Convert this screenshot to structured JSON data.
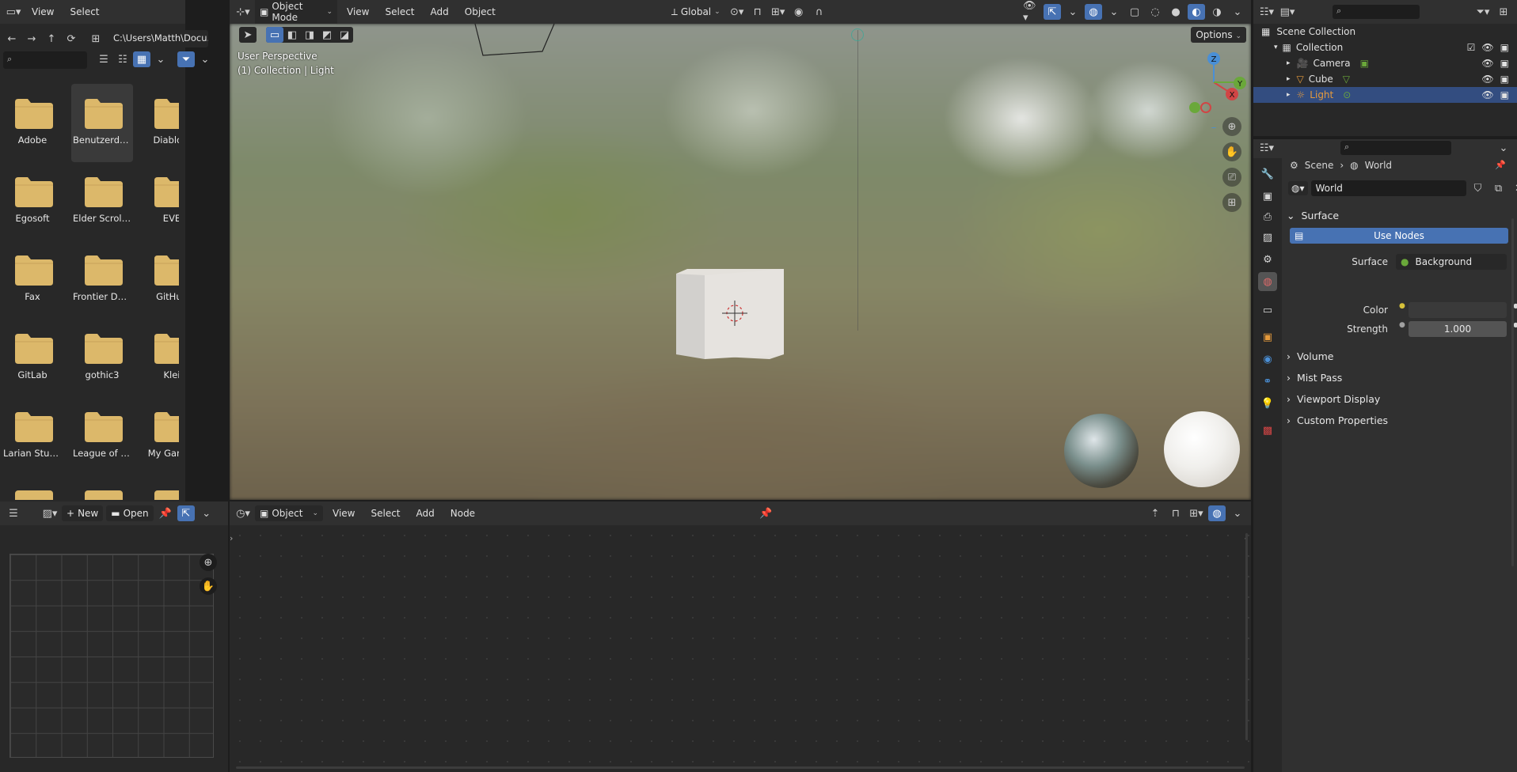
{
  "filebrowser": {
    "menu": [
      "View",
      "Select"
    ],
    "path": "C:\\Users\\Matth\\Docu...",
    "folders": [
      "Adobe",
      "Benutzerdefin...",
      "Diablo II",
      "Egosoft",
      "Elder Scrolls ...",
      "EVE",
      "Fax",
      "Frontier Deve...",
      "GitHub",
      "GitLab",
      "gothic3",
      "Klei",
      "Larian Studios",
      "League of Leg...",
      "My Games"
    ],
    "selected_folder": "Benutzerdefin..."
  },
  "viewport": {
    "mode": "Object Mode",
    "menu": [
      "View",
      "Select",
      "Add",
      "Object"
    ],
    "transform_orientation": "Global",
    "options_label": "Options",
    "overlay_title": "User Perspective",
    "overlay_subtitle": "(1) Collection | Light",
    "gizmo_axes": {
      "z": "Z",
      "x": "X",
      "y": "Y"
    }
  },
  "nodeeditor": {
    "type": "Object",
    "menu": [
      "View",
      "Select",
      "Add",
      "Node"
    ]
  },
  "imageeditor": {
    "new_label": "New",
    "open_label": "Open"
  },
  "outliner": {
    "root": "Scene Collection",
    "collection": "Collection",
    "items": [
      {
        "name": "Camera",
        "icon": "camera-icon",
        "color": "#e59a3c"
      },
      {
        "name": "Cube",
        "icon": "mesh-icon",
        "color": "#e59a3c"
      },
      {
        "name": "Light",
        "icon": "light-icon",
        "color": "#e59a3c"
      }
    ],
    "active_item": "Light"
  },
  "properties": {
    "breadcrumb": {
      "scene": "Scene",
      "world": "World"
    },
    "world_name": "World",
    "surface_panel": "Surface",
    "use_nodes_label": "Use Nodes",
    "surface_label": "Surface",
    "surface_value": "Background",
    "color_label": "Color",
    "strength_label": "Strength",
    "strength_value": "1.000",
    "collapsed_panels": [
      "Volume",
      "Mist Pass",
      "Viewport Display",
      "Custom Properties"
    ]
  },
  "colors": {
    "accent": "#4772b3",
    "folder": "#dcb86a",
    "active_row": "#334d80"
  }
}
